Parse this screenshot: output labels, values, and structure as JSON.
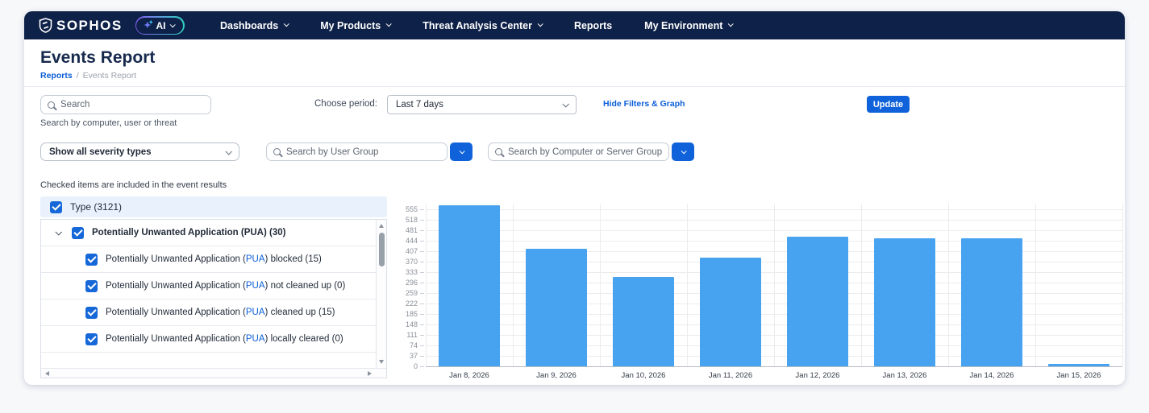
{
  "navbar": {
    "logo_text": "SOPHOS",
    "ai_label": "AI",
    "items": [
      {
        "label": "Dashboards",
        "chevron": true
      },
      {
        "label": "My Products",
        "chevron": true
      },
      {
        "label": "Threat Analysis Center",
        "chevron": true
      },
      {
        "label": "Reports",
        "chevron": false
      },
      {
        "label": "My Environment",
        "chevron": true
      }
    ]
  },
  "header": {
    "title": "Events Report",
    "breadcrumb": {
      "link": "Reports",
      "separator": "/",
      "current": "Events Report"
    }
  },
  "filters": {
    "search_placeholder": "Search",
    "search_hint": "Search by computer, user or threat",
    "period_label": "Choose period:",
    "period_value": "Last 7 days",
    "hide_link": "Hide Filters & Graph",
    "update_label": "Update",
    "severity_value": "Show all severity types",
    "user_group_placeholder": "Search by User Group",
    "computer_group_placeholder": "Search by Computer or Server Group"
  },
  "tree": {
    "note": "Checked items are included in the event results",
    "root": {
      "label": "Type (3121)",
      "checked": true
    },
    "group": {
      "label": "Potentially Unwanted Application (PUA) (30)",
      "checked": true,
      "expanded": true
    },
    "children": [
      {
        "pre": "Potentially Unwanted Application (",
        "hl": "PUA",
        "post": ") blocked (15)",
        "checked": true
      },
      {
        "pre": "Potentially Unwanted Application (",
        "hl": "PUA",
        "post": ") not cleaned up (0)",
        "checked": true
      },
      {
        "pre": "Potentially Unwanted Application (",
        "hl": "PUA",
        "post": ") cleaned up (15)",
        "checked": true
      },
      {
        "pre": "Potentially Unwanted Application (",
        "hl": "PUA",
        "post": ") locally cleared (0)",
        "checked": true
      }
    ]
  },
  "chart_data": {
    "type": "bar",
    "title": "",
    "xlabel": "",
    "ylabel": "",
    "categories": [
      "Jan 8, 2026",
      "Jan 9, 2026",
      "Jan 10, 2026",
      "Jan 11, 2026",
      "Jan 12, 2026",
      "Jan 13, 2026",
      "Jan 14, 2026",
      "Jan 15, 2026"
    ],
    "values": [
      568,
      415,
      316,
      385,
      457,
      452,
      454,
      10
    ],
    "yticks": [
      0,
      37,
      74,
      111,
      148,
      185,
      222,
      259,
      296,
      333,
      370,
      407,
      444,
      481,
      518,
      555
    ],
    "ylim": [
      0,
      575
    ],
    "grid": true,
    "legend": false,
    "bar_color": "#47a3f0"
  },
  "colors": {
    "navbar_bg": "#0e2148",
    "accent_blue": "#0f62d9",
    "link_blue": "#0b5ed7",
    "bar_blue": "#47a3f0",
    "selected_row_bg": "#e8f1fc"
  }
}
